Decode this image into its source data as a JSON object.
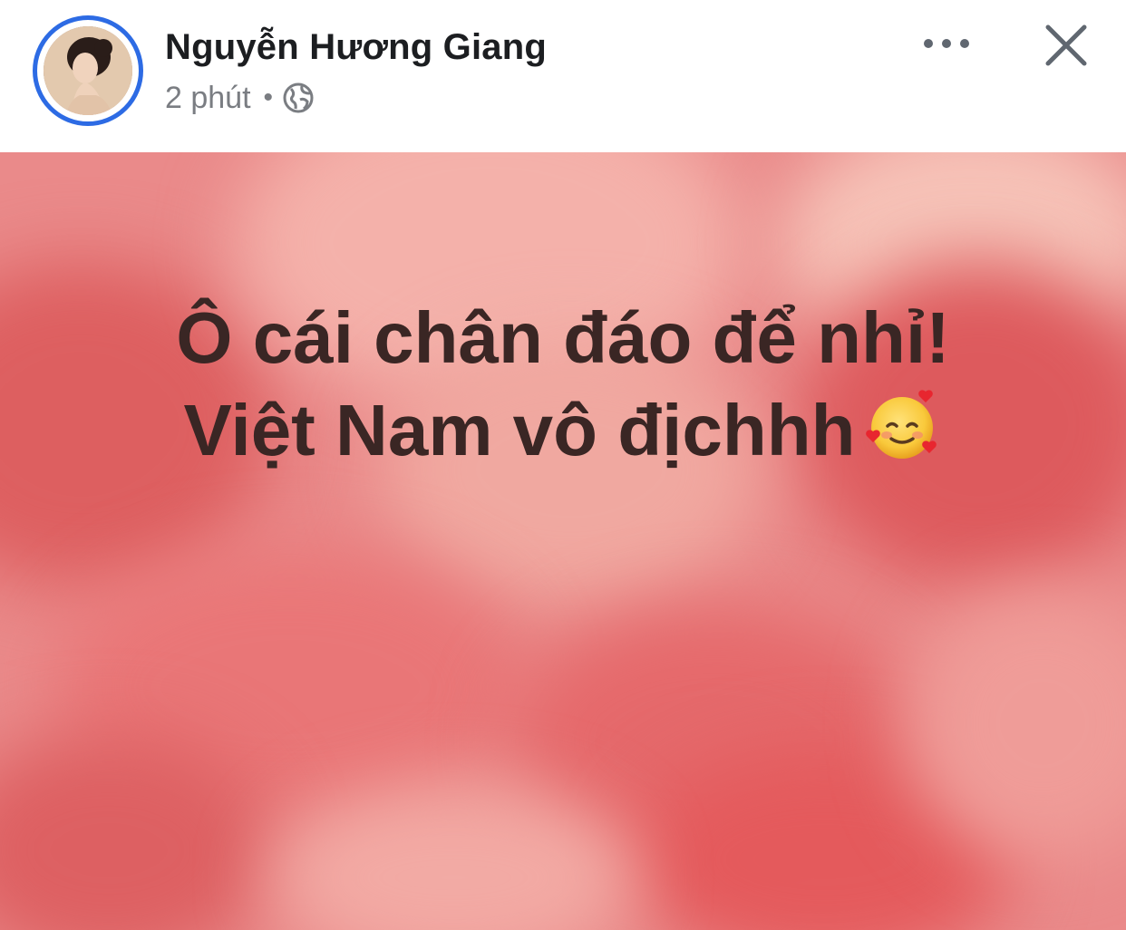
{
  "header": {
    "author_name": "Nguyễn Hương Giang",
    "time": "2 phút",
    "separator": "•",
    "privacy_icon": "globe-icon",
    "more_icon": "more-horizontal-icon",
    "close_icon": "close-icon"
  },
  "post": {
    "line1": "Ô cái chân đáo để nhỉ!",
    "line2": "Việt Nam vô địchhh",
    "emoji_icon": "smiling-face-with-hearts-icon",
    "text_color": "#3a2624",
    "background_color": "#ea8a8a"
  },
  "colors": {
    "avatar_ring": "#2d6be4",
    "name": "#1c1e21",
    "meta": "#7a7d82"
  }
}
